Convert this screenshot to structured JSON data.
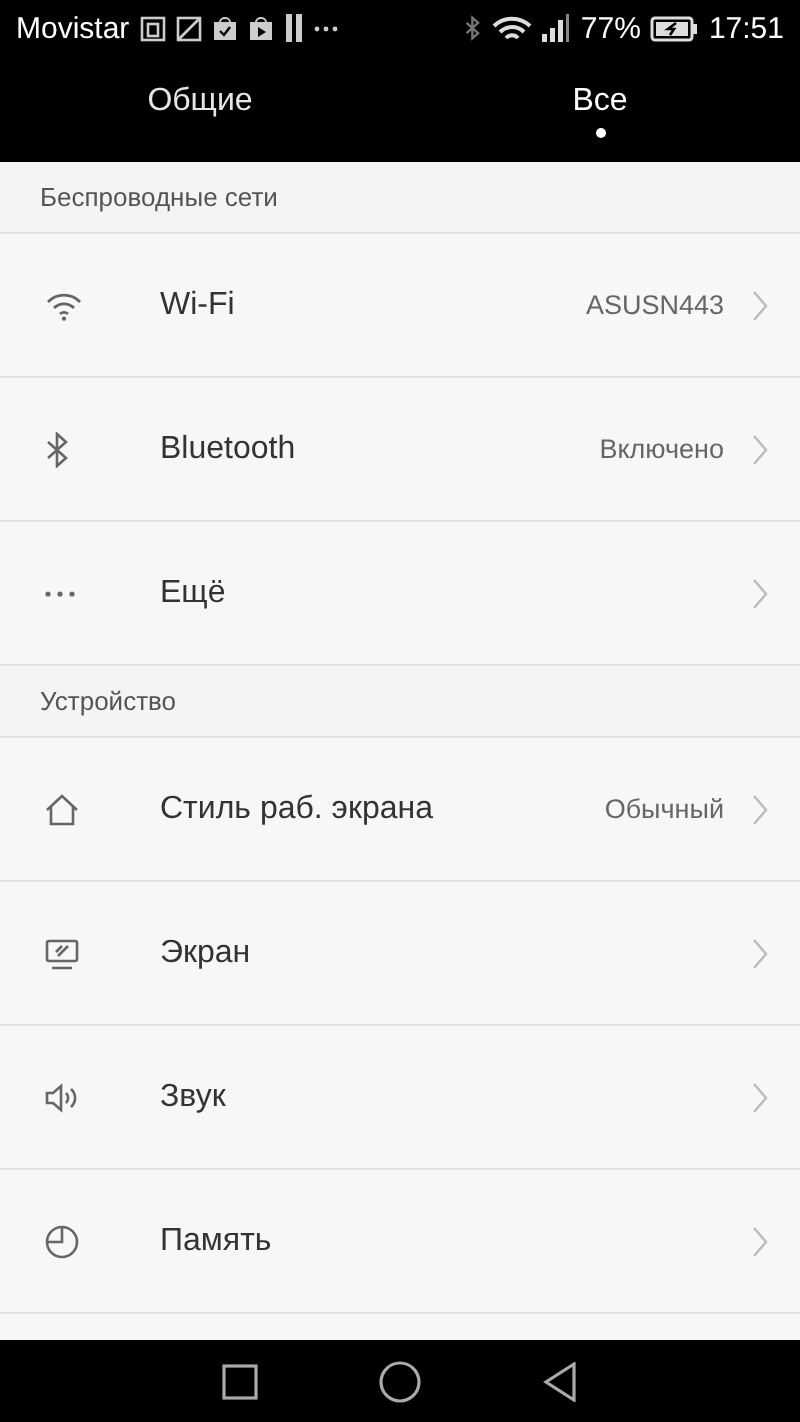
{
  "status_bar": {
    "carrier": "Movistar",
    "battery_percent": "77%",
    "time": "17:51"
  },
  "tabs": [
    {
      "label": "Общие",
      "selected": false
    },
    {
      "label": "Все",
      "selected": true
    }
  ],
  "sections": [
    {
      "header": "Беспроводные сети",
      "items": [
        {
          "kind": "wifi",
          "label": "Wi-Fi",
          "value": "ASUSN443"
        },
        {
          "kind": "bluetooth",
          "label": "Bluetooth",
          "value": "Включено"
        },
        {
          "kind": "more",
          "label": "Ещё"
        }
      ]
    },
    {
      "header": "Устройство",
      "items": [
        {
          "kind": "home",
          "label": "Стиль раб. экрана",
          "value": "Обычный"
        },
        {
          "kind": "display",
          "label": "Экран"
        },
        {
          "kind": "sound",
          "label": "Звук"
        },
        {
          "kind": "storage",
          "label": "Память"
        }
      ]
    }
  ]
}
